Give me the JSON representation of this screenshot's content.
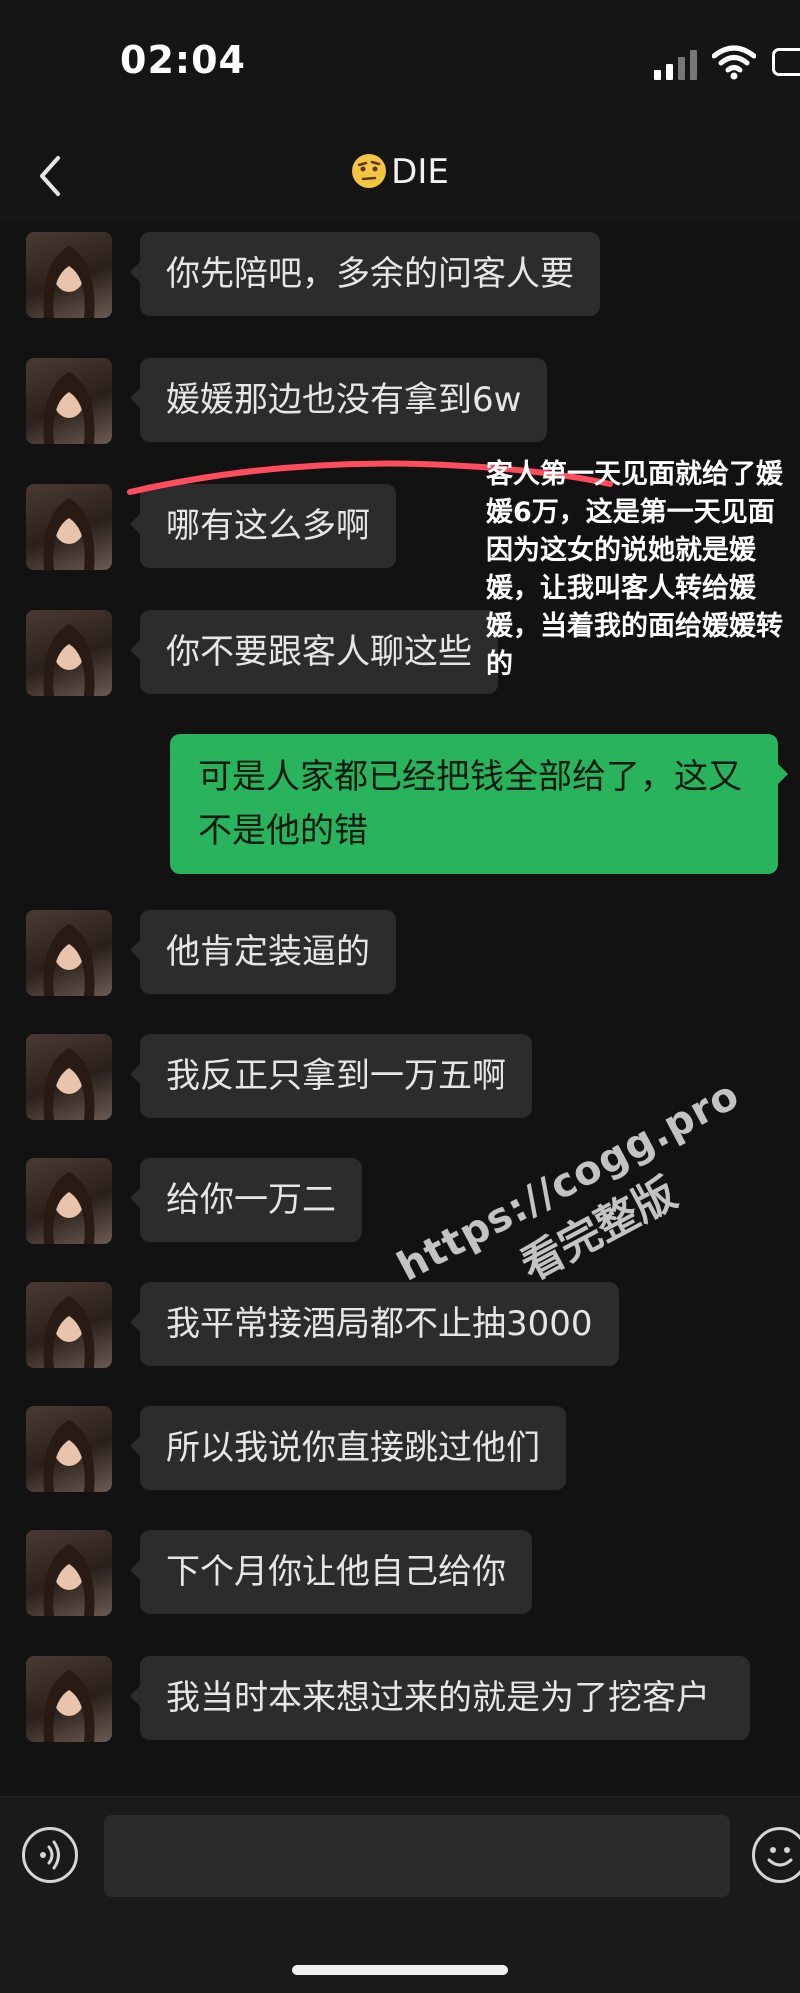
{
  "status": {
    "time": "02:04"
  },
  "header": {
    "title": "DIE"
  },
  "messages": [
    {
      "side": "in",
      "text": "你先陪吧，多余的问客人要"
    },
    {
      "side": "in",
      "text": "媛媛那边也没有拿到6w"
    },
    {
      "side": "in",
      "text": "哪有这么多啊"
    },
    {
      "side": "in",
      "text": "你不要跟客人聊这些"
    },
    {
      "side": "out",
      "text": "可是人家都已经把钱全部给了，这又不是他的错"
    },
    {
      "side": "in",
      "text": "他肯定装逼的"
    },
    {
      "side": "in",
      "text": "我反正只拿到一万五啊"
    },
    {
      "side": "in",
      "text": "给你一万二"
    },
    {
      "side": "in",
      "text": "我平常接酒局都不止抽3000"
    },
    {
      "side": "in",
      "text": "所以我说你直接跳过他们"
    },
    {
      "side": "in",
      "text": "下个月你让他自己给你"
    },
    {
      "side": "in",
      "text": "我当时本来想过来的就是为了挖客户"
    }
  ],
  "annotation": "客人第一天见面就给了媛\n媛6万，这是第一天见面\n因为这女的说她就是媛\n媛，让我叫客人转给媛\n媛，当着我的面给媛媛转\n的",
  "watermark": {
    "line1": "https://cogg.pro",
    "line2": "看完整版"
  },
  "colors": {
    "incoming": "#2c2c2c",
    "outgoing": "#29b35c",
    "highlight_line": "#ff4d5e"
  }
}
